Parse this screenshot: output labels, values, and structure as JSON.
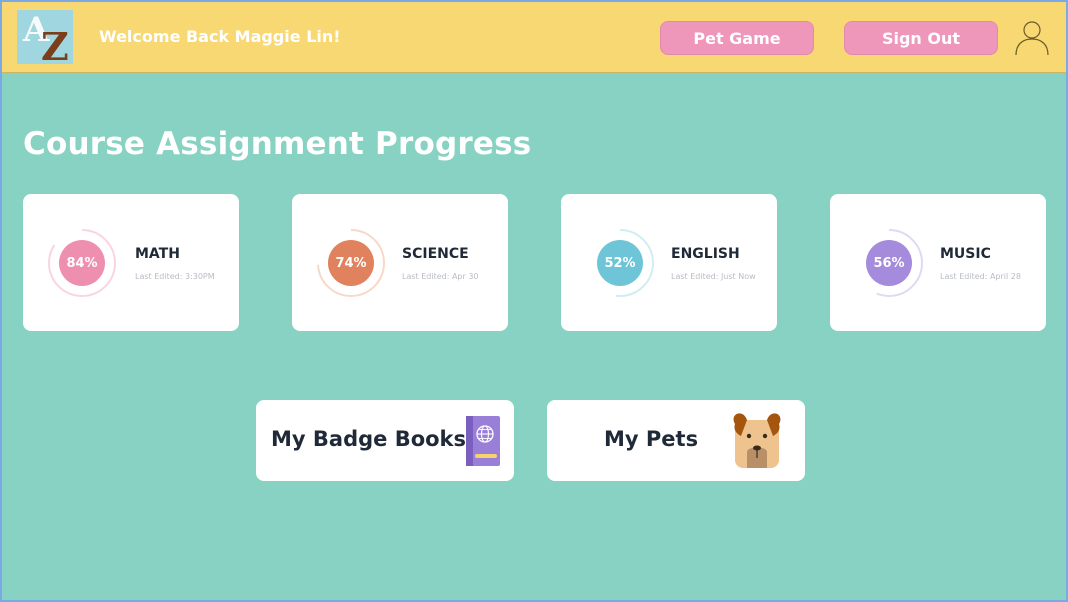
{
  "header": {
    "logo_letters": "AZ",
    "welcome": "Welcome Back Maggie Lin!",
    "pet_game_label": "Pet Game",
    "sign_out_label": "Sign Out",
    "user_icon": "user-icon"
  },
  "main": {
    "heading": "Course Assignment Progress",
    "courses": [
      {
        "subject": "MATH",
        "percent": "84%",
        "progress": 0.84,
        "edited": "Last Edited: 3:30PM",
        "color": "#ef8fb0",
        "ring": "#f9d5e2"
      },
      {
        "subject": "SCIENCE",
        "percent": "74%",
        "progress": 0.74,
        "edited": "Last Edited: Apr 30",
        "color": "#e0825d",
        "ring": "#f8d9c8"
      },
      {
        "subject": "ENGLISH",
        "percent": "52%",
        "progress": 0.52,
        "edited": "Last Edited: Just Now",
        "color": "#6ec5d8",
        "ring": "#d1edf3"
      },
      {
        "subject": "MUSIC",
        "percent": "56%",
        "progress": 0.56,
        "edited": "Last Edited: April 28",
        "color": "#a48bdb",
        "ring": "#e1d9f3"
      }
    ],
    "badge_books_label": "My Badge Books",
    "pets_label": "My Pets"
  },
  "colors": {
    "header_bg": "#f8d872",
    "page_bg": "#87d2c3",
    "button_bg": "#ef96bb"
  }
}
